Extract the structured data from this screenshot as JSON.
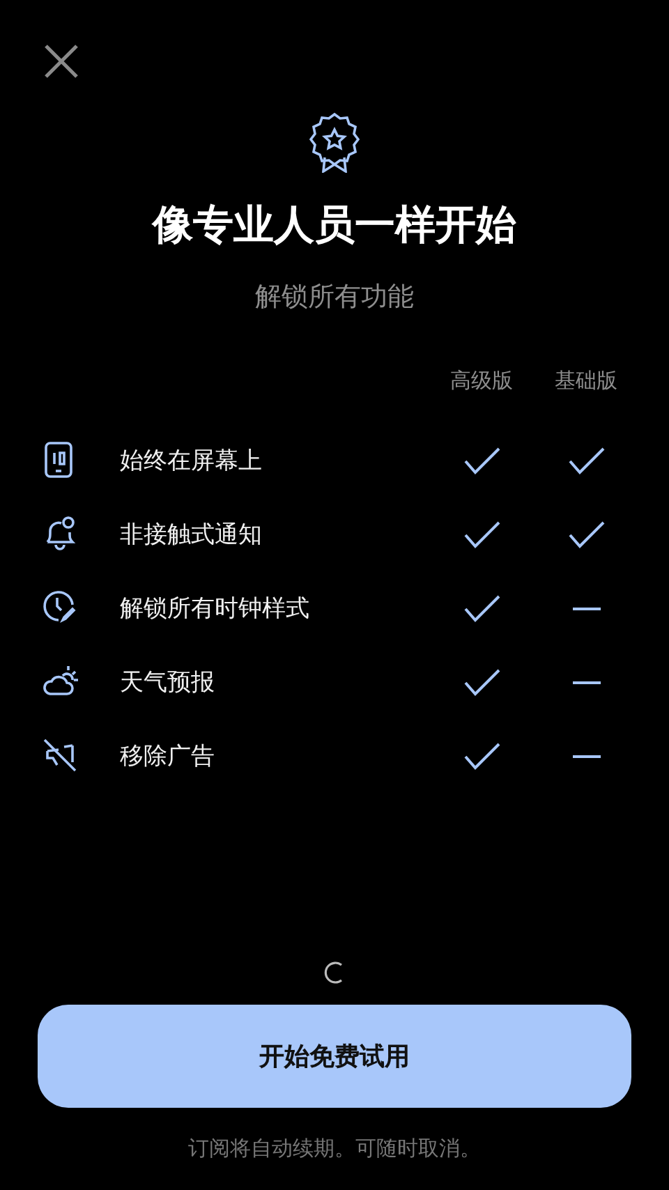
{
  "title": "像专业人员一样开始",
  "subtitle": "解锁所有功能",
  "columns": [
    "高级版",
    "基础版"
  ],
  "features": [
    {
      "label": "始终在屏幕上",
      "premium": true,
      "basic": true
    },
    {
      "label": "非接触式通知",
      "premium": true,
      "basic": true
    },
    {
      "label": "解锁所有时钟样式",
      "premium": true,
      "basic": false
    },
    {
      "label": "天气预报",
      "premium": true,
      "basic": false
    },
    {
      "label": "移除广告",
      "premium": true,
      "basic": false
    }
  ],
  "cta": "开始免费试用",
  "footnote": "订阅将自动续期。可随时取消。"
}
